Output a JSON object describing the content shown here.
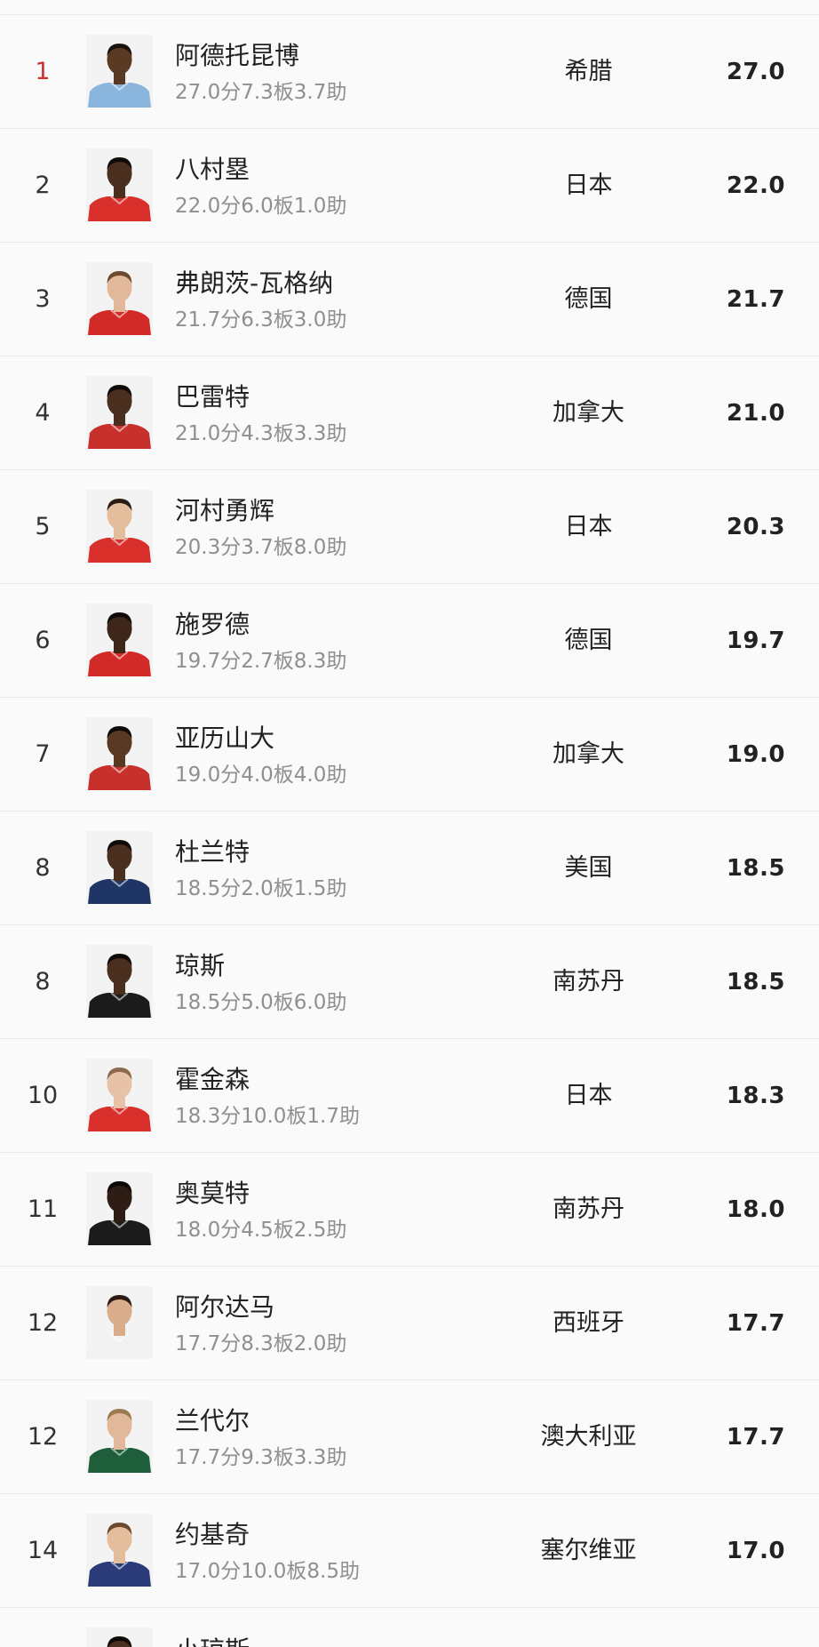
{
  "players": [
    {
      "rank": "1",
      "name": "阿德托昆博",
      "stats": "27.0分7.3板3.7助",
      "country": "希腊",
      "score": "27.0",
      "jersey": "#8ab6de",
      "skin": "#5b3a24",
      "hair": "#1a120c"
    },
    {
      "rank": "2",
      "name": "八村塁",
      "stats": "22.0分6.0板1.0助",
      "country": "日本",
      "score": "22.0",
      "jersey": "#d9302c",
      "skin": "#4a2f1f",
      "hair": "#0f0a08"
    },
    {
      "rank": "3",
      "name": "弗朗茨-瓦格纳",
      "stats": "21.7分6.3板3.0助",
      "country": "德国",
      "score": "21.7",
      "jersey": "#d22a26",
      "skin": "#e2b89a",
      "hair": "#6b4a30"
    },
    {
      "rank": "4",
      "name": "巴雷特",
      "stats": "21.0分4.3板3.3助",
      "country": "加拿大",
      "score": "21.0",
      "jersey": "#c8302c",
      "skin": "#4a2f1f",
      "hair": "#0f0a08"
    },
    {
      "rank": "5",
      "name": "河村勇辉",
      "stats": "20.3分3.7板8.0助",
      "country": "日本",
      "score": "20.3",
      "jersey": "#d9302c",
      "skin": "#e4bd9c",
      "hair": "#2a1c14"
    },
    {
      "rank": "6",
      "name": "施罗德",
      "stats": "19.7分2.7板8.3助",
      "country": "德国",
      "score": "19.7",
      "jersey": "#d22a26",
      "skin": "#3e271a",
      "hair": "#0f0a08"
    },
    {
      "rank": "7",
      "name": "亚历山大",
      "stats": "19.0分4.0板4.0助",
      "country": "加拿大",
      "score": "19.0",
      "jersey": "#c8302c",
      "skin": "#5a3924",
      "hair": "#0f0a08"
    },
    {
      "rank": "8",
      "name": "杜兰特",
      "stats": "18.5分2.0板1.5助",
      "country": "美国",
      "score": "18.5",
      "jersey": "#1f3565",
      "skin": "#4a2f1f",
      "hair": "#0f0a08"
    },
    {
      "rank": "8",
      "name": "琼斯",
      "stats": "18.5分5.0板6.0助",
      "country": "南苏丹",
      "score": "18.5",
      "jersey": "#1b1b1b",
      "skin": "#4a2f1f",
      "hair": "#0f0a08"
    },
    {
      "rank": "10",
      "name": "霍金森",
      "stats": "18.3分10.0板1.7助",
      "country": "日本",
      "score": "18.3",
      "jersey": "#d9302c",
      "skin": "#e8c2a6",
      "hair": "#8a6a4a"
    },
    {
      "rank": "11",
      "name": "奥莫特",
      "stats": "18.0分4.5板2.5助",
      "country": "南苏丹",
      "score": "18.0",
      "jersey": "#1b1b1b",
      "skin": "#2e1d14",
      "hair": "#0a0706"
    },
    {
      "rank": "12",
      "name": "阿尔达马",
      "stats": "17.7分8.3板2.0助",
      "country": "西班牙",
      "score": "17.7",
      "jersey": "#f2f2f2",
      "skin": "#d9ad8c",
      "hair": "#2a1c14"
    },
    {
      "rank": "12",
      "name": "兰代尔",
      "stats": "17.7分9.3板3.3助",
      "country": "澳大利亚",
      "score": "17.7",
      "jersey": "#1e5e3a",
      "skin": "#e2b89a",
      "hair": "#9a7a4e"
    },
    {
      "rank": "14",
      "name": "约基奇",
      "stats": "17.0分10.0板8.5助",
      "country": "塞尔维亚",
      "score": "17.0",
      "jersey": "#2b3a78",
      "skin": "#e4bd9c",
      "hair": "#6b4a30"
    }
  ],
  "partial_row": {
    "name": "小琼斯",
    "jersey": "#1b1b1b",
    "skin": "#4a2f1f",
    "hair": "#0f0a08"
  }
}
